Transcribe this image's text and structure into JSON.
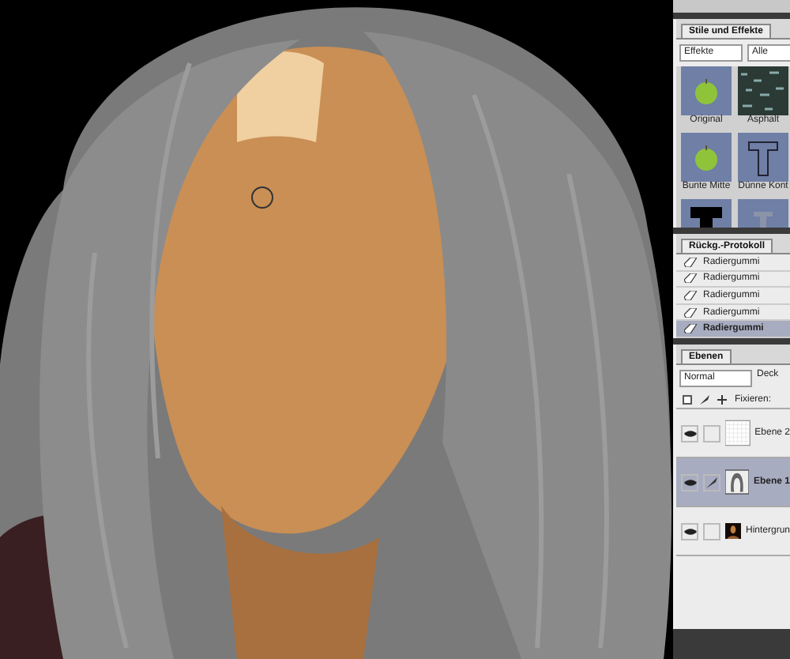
{
  "styles_panel": {
    "tab": "Stile und Effekte",
    "category": "Effekte",
    "filter": "Alle",
    "items": [
      {
        "label": "Original",
        "kind": "apple"
      },
      {
        "label": "Asphalt",
        "kind": "texture"
      },
      {
        "label": "Bunte Mitte",
        "kind": "apple"
      },
      {
        "label": "Dünne Kont",
        "kind": "outline"
      },
      {
        "kind": "bold"
      },
      {
        "kind": "smoke"
      }
    ]
  },
  "history_panel": {
    "tab": "Rückg.-Protokoll",
    "items": [
      {
        "label": "Radiergummi",
        "selected": false
      },
      {
        "label": "Radiergummi",
        "selected": false
      },
      {
        "label": "Radiergummi",
        "selected": false
      },
      {
        "label": "Radiergummi",
        "selected": false
      },
      {
        "label": "Radiergummi",
        "selected": true
      }
    ]
  },
  "layers_panel": {
    "tab": "Ebenen",
    "blend_mode": "Normal",
    "opacity_label": "Deck",
    "lock_label": "Fixieren:",
    "layers": [
      {
        "name": "Ebene 2",
        "kind": "empty",
        "visible": true,
        "selected": false
      },
      {
        "name": "Ebene 1",
        "kind": "hair",
        "visible": true,
        "selected": true
      },
      {
        "name": "Hintergrun",
        "kind": "portrait",
        "visible": true,
        "selected": false
      }
    ]
  }
}
